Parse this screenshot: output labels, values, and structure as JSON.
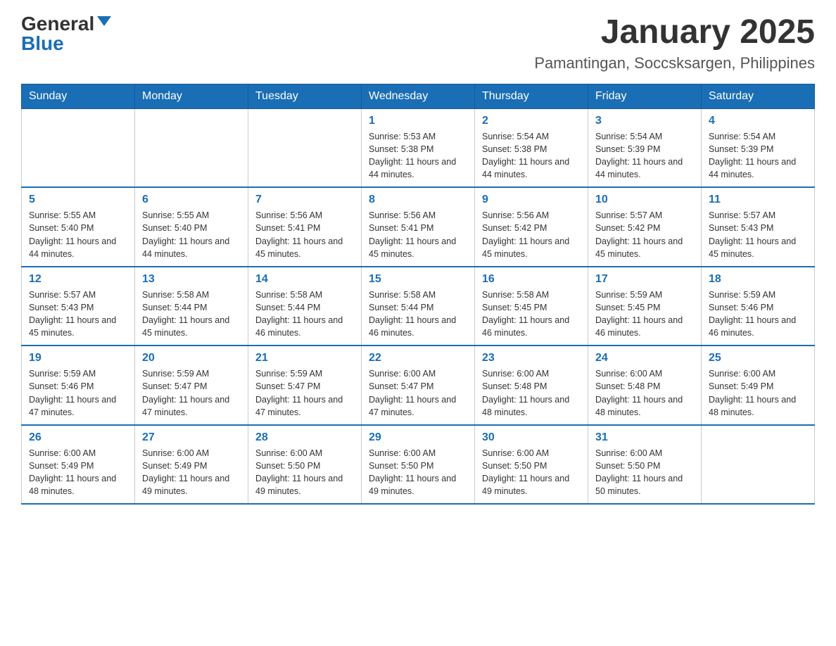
{
  "logo": {
    "general": "General",
    "blue": "Blue"
  },
  "title": "January 2025",
  "subtitle": "Pamantingan, Soccsksargen, Philippines",
  "weekdays": [
    "Sunday",
    "Monday",
    "Tuesday",
    "Wednesday",
    "Thursday",
    "Friday",
    "Saturday"
  ],
  "weeks": [
    [
      {
        "day": "",
        "info": ""
      },
      {
        "day": "",
        "info": ""
      },
      {
        "day": "",
        "info": ""
      },
      {
        "day": "1",
        "info": "Sunrise: 5:53 AM\nSunset: 5:38 PM\nDaylight: 11 hours and 44 minutes."
      },
      {
        "day": "2",
        "info": "Sunrise: 5:54 AM\nSunset: 5:38 PM\nDaylight: 11 hours and 44 minutes."
      },
      {
        "day": "3",
        "info": "Sunrise: 5:54 AM\nSunset: 5:39 PM\nDaylight: 11 hours and 44 minutes."
      },
      {
        "day": "4",
        "info": "Sunrise: 5:54 AM\nSunset: 5:39 PM\nDaylight: 11 hours and 44 minutes."
      }
    ],
    [
      {
        "day": "5",
        "info": "Sunrise: 5:55 AM\nSunset: 5:40 PM\nDaylight: 11 hours and 44 minutes."
      },
      {
        "day": "6",
        "info": "Sunrise: 5:55 AM\nSunset: 5:40 PM\nDaylight: 11 hours and 44 minutes."
      },
      {
        "day": "7",
        "info": "Sunrise: 5:56 AM\nSunset: 5:41 PM\nDaylight: 11 hours and 45 minutes."
      },
      {
        "day": "8",
        "info": "Sunrise: 5:56 AM\nSunset: 5:41 PM\nDaylight: 11 hours and 45 minutes."
      },
      {
        "day": "9",
        "info": "Sunrise: 5:56 AM\nSunset: 5:42 PM\nDaylight: 11 hours and 45 minutes."
      },
      {
        "day": "10",
        "info": "Sunrise: 5:57 AM\nSunset: 5:42 PM\nDaylight: 11 hours and 45 minutes."
      },
      {
        "day": "11",
        "info": "Sunrise: 5:57 AM\nSunset: 5:43 PM\nDaylight: 11 hours and 45 minutes."
      }
    ],
    [
      {
        "day": "12",
        "info": "Sunrise: 5:57 AM\nSunset: 5:43 PM\nDaylight: 11 hours and 45 minutes."
      },
      {
        "day": "13",
        "info": "Sunrise: 5:58 AM\nSunset: 5:44 PM\nDaylight: 11 hours and 45 minutes."
      },
      {
        "day": "14",
        "info": "Sunrise: 5:58 AM\nSunset: 5:44 PM\nDaylight: 11 hours and 46 minutes."
      },
      {
        "day": "15",
        "info": "Sunrise: 5:58 AM\nSunset: 5:44 PM\nDaylight: 11 hours and 46 minutes."
      },
      {
        "day": "16",
        "info": "Sunrise: 5:58 AM\nSunset: 5:45 PM\nDaylight: 11 hours and 46 minutes."
      },
      {
        "day": "17",
        "info": "Sunrise: 5:59 AM\nSunset: 5:45 PM\nDaylight: 11 hours and 46 minutes."
      },
      {
        "day": "18",
        "info": "Sunrise: 5:59 AM\nSunset: 5:46 PM\nDaylight: 11 hours and 46 minutes."
      }
    ],
    [
      {
        "day": "19",
        "info": "Sunrise: 5:59 AM\nSunset: 5:46 PM\nDaylight: 11 hours and 47 minutes."
      },
      {
        "day": "20",
        "info": "Sunrise: 5:59 AM\nSunset: 5:47 PM\nDaylight: 11 hours and 47 minutes."
      },
      {
        "day": "21",
        "info": "Sunrise: 5:59 AM\nSunset: 5:47 PM\nDaylight: 11 hours and 47 minutes."
      },
      {
        "day": "22",
        "info": "Sunrise: 6:00 AM\nSunset: 5:47 PM\nDaylight: 11 hours and 47 minutes."
      },
      {
        "day": "23",
        "info": "Sunrise: 6:00 AM\nSunset: 5:48 PM\nDaylight: 11 hours and 48 minutes."
      },
      {
        "day": "24",
        "info": "Sunrise: 6:00 AM\nSunset: 5:48 PM\nDaylight: 11 hours and 48 minutes."
      },
      {
        "day": "25",
        "info": "Sunrise: 6:00 AM\nSunset: 5:49 PM\nDaylight: 11 hours and 48 minutes."
      }
    ],
    [
      {
        "day": "26",
        "info": "Sunrise: 6:00 AM\nSunset: 5:49 PM\nDaylight: 11 hours and 48 minutes."
      },
      {
        "day": "27",
        "info": "Sunrise: 6:00 AM\nSunset: 5:49 PM\nDaylight: 11 hours and 49 minutes."
      },
      {
        "day": "28",
        "info": "Sunrise: 6:00 AM\nSunset: 5:50 PM\nDaylight: 11 hours and 49 minutes."
      },
      {
        "day": "29",
        "info": "Sunrise: 6:00 AM\nSunset: 5:50 PM\nDaylight: 11 hours and 49 minutes."
      },
      {
        "day": "30",
        "info": "Sunrise: 6:00 AM\nSunset: 5:50 PM\nDaylight: 11 hours and 49 minutes."
      },
      {
        "day": "31",
        "info": "Sunrise: 6:00 AM\nSunset: 5:50 PM\nDaylight: 11 hours and 50 minutes."
      },
      {
        "day": "",
        "info": ""
      }
    ]
  ]
}
